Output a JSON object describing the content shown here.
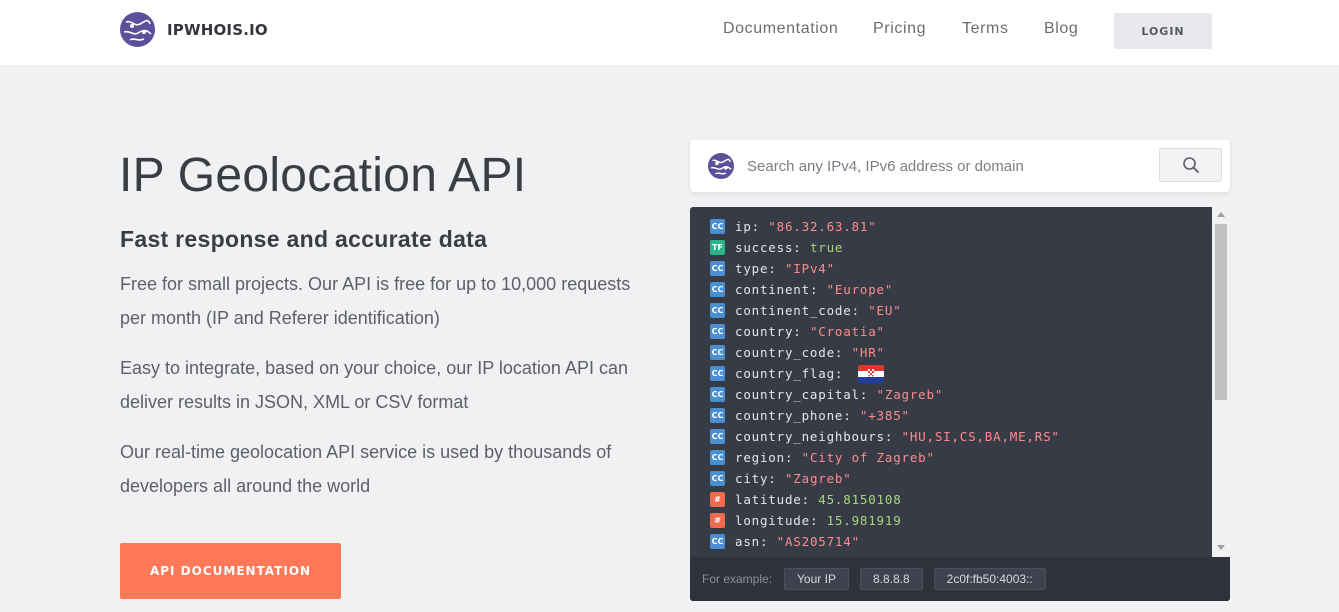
{
  "header": {
    "brand": "IPWHOIS.IO",
    "nav": [
      "Documentation",
      "Pricing",
      "Terms",
      "Blog"
    ],
    "login_label": "LOGIN"
  },
  "hero": {
    "title": "IP Geolocation API",
    "subtitle": "Fast response and accurate data",
    "paragraphs": [
      "Free for small projects. Our API is free for up to 10,000 requests per month (IP and Referer identification)",
      "Easy to integrate, based on your choice, our IP location API can deliver results in JSON, XML or CSV format",
      "Our real-time geolocation API service is used by thousands of developers all around the world"
    ],
    "cta_label": "API DOCUMENTATION"
  },
  "search": {
    "placeholder": "Search any IPv4, IPv6 address or domain"
  },
  "result": {
    "lines": [
      {
        "badge": "CC",
        "key": "ip",
        "value": "\"86.32.63.81\"",
        "kind": "str"
      },
      {
        "badge": "TF",
        "key": "success",
        "value": "true",
        "kind": "bool"
      },
      {
        "badge": "CC",
        "key": "type",
        "value": "\"IPv4\"",
        "kind": "str"
      },
      {
        "badge": "CC",
        "key": "continent",
        "value": "\"Europe\"",
        "kind": "str"
      },
      {
        "badge": "CC",
        "key": "continent_code",
        "value": "\"EU\"",
        "kind": "str"
      },
      {
        "badge": "CC",
        "key": "country",
        "value": "\"Croatia\"",
        "kind": "str"
      },
      {
        "badge": "CC",
        "key": "country_code",
        "value": "\"HR\"",
        "kind": "str"
      },
      {
        "badge": "CC",
        "key": "country_flag",
        "value": "",
        "kind": "flag"
      },
      {
        "badge": "CC",
        "key": "country_capital",
        "value": "\"Zagreb\"",
        "kind": "str"
      },
      {
        "badge": "CC",
        "key": "country_phone",
        "value": "\"+385\"",
        "kind": "str"
      },
      {
        "badge": "CC",
        "key": "country_neighbours",
        "value": "\"HU,SI,CS,BA,ME,RS\"",
        "kind": "str"
      },
      {
        "badge": "CC",
        "key": "region",
        "value": "\"City of Zagreb\"",
        "kind": "str"
      },
      {
        "badge": "CC",
        "key": "city",
        "value": "\"Zagreb\"",
        "kind": "str"
      },
      {
        "badge": "#",
        "key": "latitude",
        "value": "45.8150108",
        "kind": "num"
      },
      {
        "badge": "#",
        "key": "longitude",
        "value": "15.981919",
        "kind": "num"
      },
      {
        "badge": "CC",
        "key": "asn",
        "value": "\"AS205714\"",
        "kind": "str"
      }
    ],
    "footer": {
      "label": "For example:",
      "examples": [
        "Your IP",
        "8.8.8.8",
        "2c0f:fb50:4003::"
      ]
    }
  },
  "colors": {
    "accent": "#ff7958",
    "brand": "#5e4f9b",
    "code_bg": "#363b46",
    "string": "#fe8b8b",
    "number": "#a8d67c"
  }
}
